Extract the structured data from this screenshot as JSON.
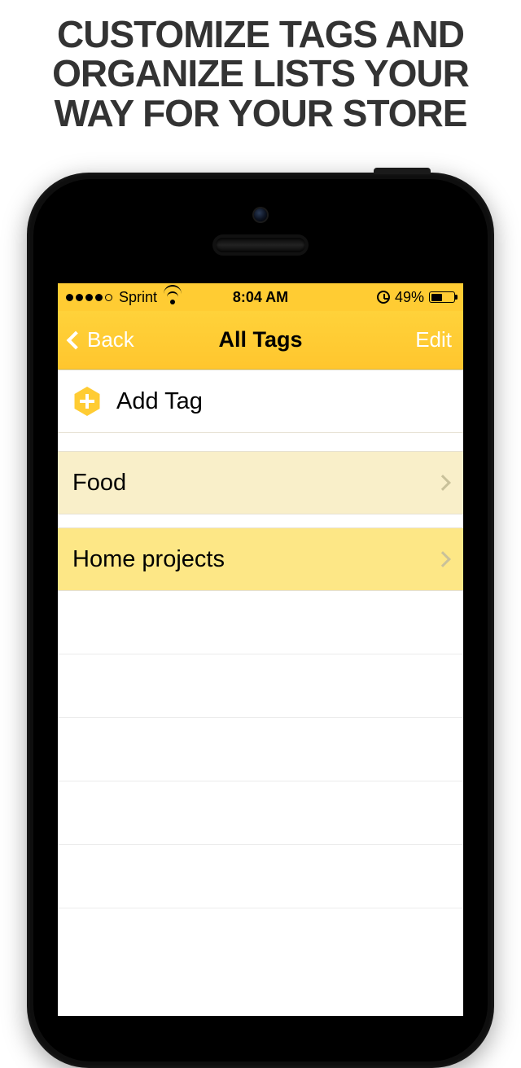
{
  "promo": {
    "headline": "CUSTOMIZE TAGS AND ORGANIZE LISTS YOUR WAY FOR YOUR STORE"
  },
  "statusbar": {
    "carrier": "Sprint",
    "time": "8:04 AM",
    "battery_percent": "49%",
    "battery_level": 0.49,
    "alarm_set": true,
    "signal_dots_filled": 4,
    "signal_dots_total": 5
  },
  "nav": {
    "back_label": "Back",
    "title": "All Tags",
    "edit_label": "Edit"
  },
  "content": {
    "add_tag_label": "Add Tag",
    "tags": [
      {
        "label": "Food"
      },
      {
        "label": "Home projects"
      }
    ]
  },
  "colors": {
    "accent": "#FFCC33",
    "row_shade_light": "#F9EFC9",
    "row_shade_dark": "#FDE786"
  }
}
